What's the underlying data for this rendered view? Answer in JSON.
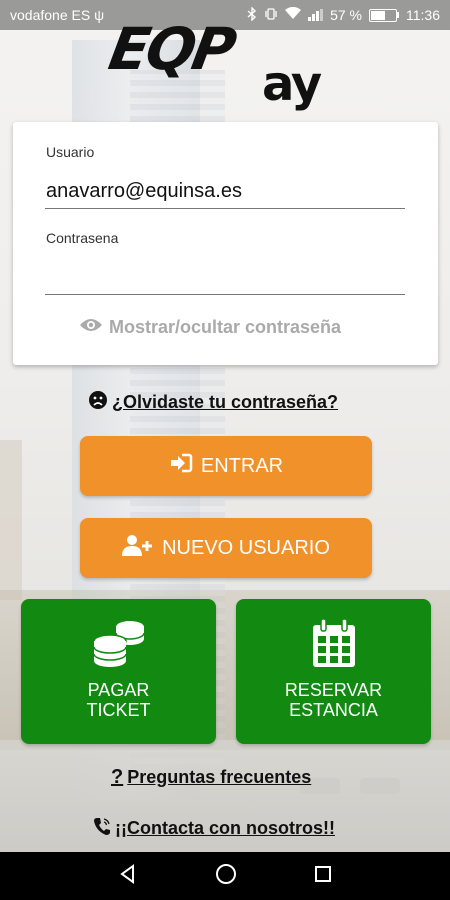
{
  "status_bar": {
    "carrier": "vodafone ES",
    "usb_glyph": "ψ",
    "battery_percent": "57 %",
    "battery_level": 0.57,
    "time": "11:36"
  },
  "logo": {
    "part1": "EQP",
    "part2": "ay"
  },
  "login": {
    "user_label": "Usuario",
    "user_value": "anavarro@equinsa.es",
    "password_label": "Contrasena",
    "password_value": "",
    "toggle_password": "Mostrar/ocultar contraseña"
  },
  "links": {
    "forgot_password": "¿Olvidaste tu contraseña?",
    "faq": "Preguntas frecuentes",
    "contact": "¡¡Contacta con nosotros!!"
  },
  "buttons": {
    "enter": "ENTRAR",
    "new_user": "NUEVO USUARIO",
    "pay_ticket_line1": "PAGAR",
    "pay_ticket_line2": "TICKET",
    "reserve_line1": "RESERVAR",
    "reserve_line2": "ESTANCIA"
  },
  "icons": {
    "eye": "eye-icon",
    "sad_face": "sad-face-icon",
    "enter": "sign-in-icon",
    "add_user": "user-plus-icon",
    "coins": "coins-icon",
    "calendar": "calendar-icon",
    "question": "question-icon",
    "phone": "phone-icon",
    "back": "back-icon",
    "home": "home-icon",
    "recents": "recents-icon"
  },
  "colors": {
    "orange": "#f0912a",
    "green": "#128a12",
    "link_text": "#111111",
    "hint_gray": "#aaaaaa"
  }
}
